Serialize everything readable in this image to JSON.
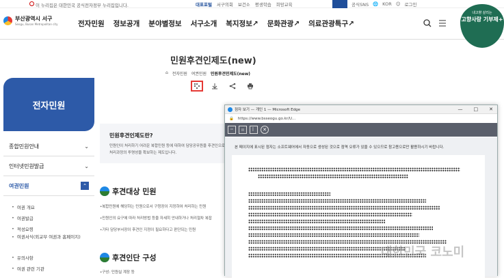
{
  "topbar": {
    "notice": "이 누리집은 대한민국 공식전자정부 누리집입니다.",
    "links": [
      "대표포털",
      "서구의회",
      "보건소",
      "평생학습",
      "희망교육"
    ],
    "sns": "공식SNS",
    "lang": "KOR",
    "login": "로그인"
  },
  "header": {
    "logo_main": "부산광역시 서구",
    "logo_sub": "Seogu, Busan Metropolitan city",
    "nav": [
      "전자민원",
      "정보공개",
      "분야별정보",
      "서구소개",
      "복지정보↗",
      "문화관광↗",
      "의료관광특구↗"
    ],
    "badge_top": "내고향 살리는",
    "badge_main": "고향사랑 기부제+"
  },
  "sidebar": {
    "title": "전자민원",
    "items": [
      {
        "label": "종합민원안내",
        "chev": "⌄"
      },
      {
        "label": "인터넷민원발급",
        "chev": "⌄"
      },
      {
        "label": "여권민원",
        "chev": "⌃"
      }
    ],
    "subitems": [
      "여권 개요",
      "여권발급",
      "적성요령",
      "여권서식(외교부 여권과 홈페이지)",
      "유의사항",
      "여권 관련 기관"
    ]
  },
  "main": {
    "title": "민원후견인제도(new)",
    "breadcrumb": [
      "⌂",
      "전자민원",
      "여권민원",
      "민원후견인제도(new)"
    ],
    "intro_heading": "민원후견인제도란?",
    "intro_lines": [
      "민원인이 처리하기 어려운 복합민원 등에 대하여 담당공무원을 후견인으로 지정하여 민원처리를 돕",
      "처리과정의 투명성을 확보하는 제도입니다."
    ],
    "section1": "후견대상 민원",
    "bullets1": [
      "복합민원에 해당하는 민원으로서 구청장이 지정하여 처리하는 민원",
      "민원인의 요구에 따라 처리방법 등을 자세히 안내하거나 처리절차 복잡",
      "기타 담당부서장이 후견인 지정이 필요하다고 판단되는 민원"
    ],
    "section2": "후견인단 구성",
    "bullets2": [
      "구성: 민원실 계장 등"
    ]
  },
  "browser": {
    "title": "점자 보기 — 개인 1 — Microsoft Edge",
    "url": "https://www.bsseogu.go.kr/U...",
    "notice": "본 페이지에 표시된 점자는 소프트웨어에서 자동으로 생성된 것으로 점역 오류가 있을 수 있으므로 참고용으로만 활용하시기 바랍니다.",
    "controls": [
      "—",
      "□",
      "✕"
    ]
  },
  "watermark": "대한민국 코노미"
}
